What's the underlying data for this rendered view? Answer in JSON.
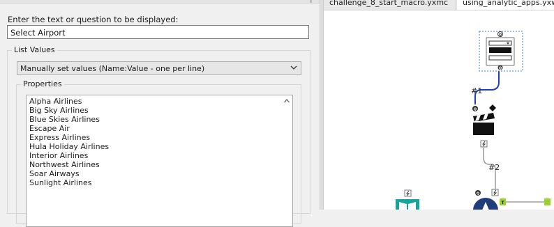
{
  "config": {
    "prompt_label": "Enter the text or question to be displayed:",
    "prompt_value": "Select Airport",
    "list_values_legend": "List Values",
    "list_mode_value": "Manually set values (Name:Value - one per line)",
    "properties_legend": "Properties",
    "properties_lines": [
      "Alpha Airlines",
      "Big Sky Airlines",
      "Blue Skies Airlines",
      "Escape Air",
      "Express Airlines",
      "Hula Holiday Airlines",
      "Interior Airlines",
      "Northwest Airlines",
      "Soar Airways",
      "Sunlight Airlines"
    ]
  },
  "tabs": [
    {
      "label": "challenge_8_start_macro.yxmc"
    },
    {
      "label": "using_analytic_apps.yxwz"
    }
  ],
  "workflow": {
    "connection_labels": [
      "#1",
      "#2"
    ],
    "tools": [
      {
        "name": "drop-down-tool",
        "icon": "dropdown-icon"
      },
      {
        "name": "action-tool",
        "icon": "clapperboard-icon"
      },
      {
        "name": "book-tool",
        "icon": "book-icon"
      },
      {
        "name": "macro-output-tool",
        "icon": "wizard-icon"
      }
    ]
  },
  "colors": {
    "connection": "#1f3fbf",
    "anchor": "#333333",
    "teal": "#17a49e",
    "navy": "#1f3d7a",
    "tool_border": "#3a87c8",
    "green_anchor": "#9bd22a"
  }
}
